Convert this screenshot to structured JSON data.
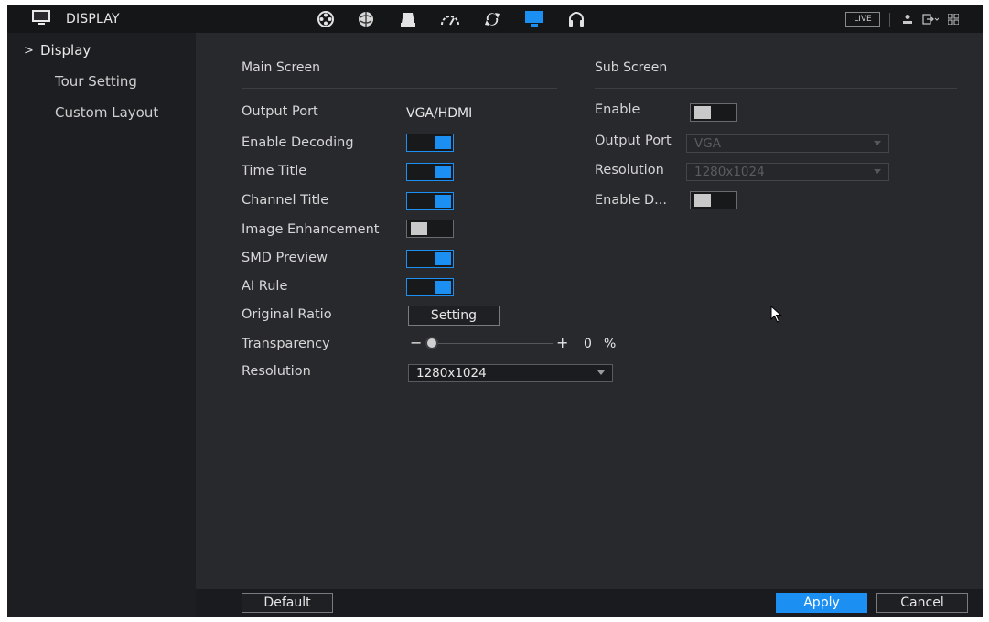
{
  "app": {
    "title": "DISPLAY",
    "live_label": "LIVE"
  },
  "toolbar_icons": [
    "camera-reel-icon",
    "network-icon",
    "storage-icon",
    "dashboard-icon",
    "sync-icon",
    "display-icon",
    "headphones-icon"
  ],
  "sidebar": {
    "items": [
      {
        "label": "Display",
        "active": true
      },
      {
        "label": "Tour Setting",
        "active": false
      },
      {
        "label": "Custom Layout",
        "active": false
      }
    ]
  },
  "main_screen": {
    "title": "Main Screen",
    "output_port_label": "Output Port",
    "output_port_value": "VGA/HDMI",
    "enable_decoding_label": "Enable Decoding",
    "enable_decoding_on": true,
    "time_title_label": "Time Title",
    "time_title_on": true,
    "channel_title_label": "Channel Title",
    "channel_title_on": true,
    "image_enhancement_label": "Image Enhancement",
    "image_enhancement_on": false,
    "smd_preview_label": "SMD Preview",
    "smd_preview_on": true,
    "ai_rule_label": "AI Rule",
    "ai_rule_on": true,
    "original_ratio_label": "Original Ratio",
    "setting_button": "Setting",
    "transparency_label": "Transparency",
    "transparency_minus": "−",
    "transparency_plus": "+",
    "transparency_value": "0",
    "transparency_unit": "%",
    "transparency_level": 0,
    "resolution_label": "Resolution",
    "resolution_value": "1280x1024"
  },
  "sub_screen": {
    "title": "Sub Screen",
    "enable_label": "Enable",
    "enable_on": false,
    "output_port_label": "Output Port",
    "output_port_value": "VGA",
    "resolution_label": "Resolution",
    "resolution_value": "1280x1024",
    "enable_decoding_label": "Enable D...",
    "enable_decoding_on": false
  },
  "footer": {
    "default_button": "Default",
    "apply_button": "Apply",
    "cancel_button": "Cancel"
  },
  "colors": {
    "accent": "#1b8ff2",
    "background": "#28292d",
    "sidebar": "#1d1e21",
    "topbar": "#151618"
  }
}
